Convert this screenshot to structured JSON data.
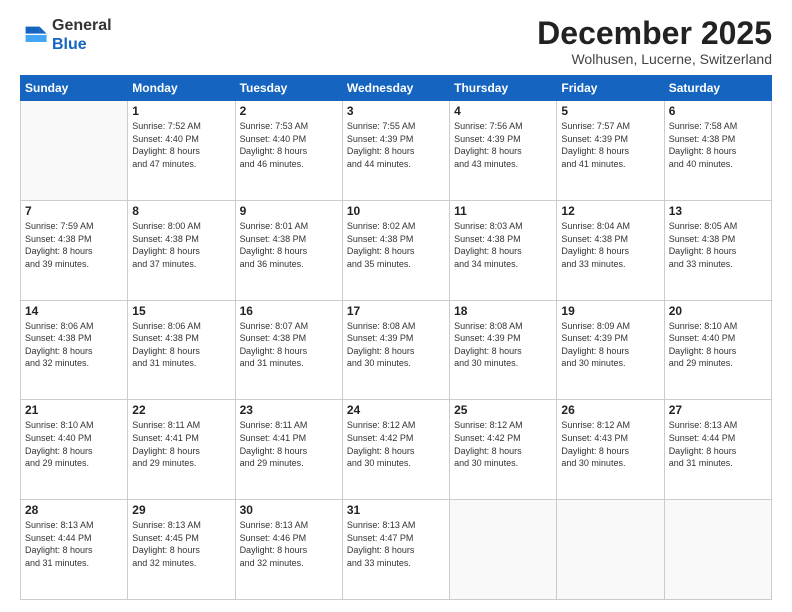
{
  "logo": {
    "general": "General",
    "blue": "Blue"
  },
  "header": {
    "month": "December 2025",
    "location": "Wolhusen, Lucerne, Switzerland"
  },
  "days_of_week": [
    "Sunday",
    "Monday",
    "Tuesday",
    "Wednesday",
    "Thursday",
    "Friday",
    "Saturday"
  ],
  "weeks": [
    [
      {
        "day": "",
        "info": ""
      },
      {
        "day": "1",
        "info": "Sunrise: 7:52 AM\nSunset: 4:40 PM\nDaylight: 8 hours\nand 47 minutes."
      },
      {
        "day": "2",
        "info": "Sunrise: 7:53 AM\nSunset: 4:40 PM\nDaylight: 8 hours\nand 46 minutes."
      },
      {
        "day": "3",
        "info": "Sunrise: 7:55 AM\nSunset: 4:39 PM\nDaylight: 8 hours\nand 44 minutes."
      },
      {
        "day": "4",
        "info": "Sunrise: 7:56 AM\nSunset: 4:39 PM\nDaylight: 8 hours\nand 43 minutes."
      },
      {
        "day": "5",
        "info": "Sunrise: 7:57 AM\nSunset: 4:39 PM\nDaylight: 8 hours\nand 41 minutes."
      },
      {
        "day": "6",
        "info": "Sunrise: 7:58 AM\nSunset: 4:38 PM\nDaylight: 8 hours\nand 40 minutes."
      }
    ],
    [
      {
        "day": "7",
        "info": "Sunrise: 7:59 AM\nSunset: 4:38 PM\nDaylight: 8 hours\nand 39 minutes."
      },
      {
        "day": "8",
        "info": "Sunrise: 8:00 AM\nSunset: 4:38 PM\nDaylight: 8 hours\nand 37 minutes."
      },
      {
        "day": "9",
        "info": "Sunrise: 8:01 AM\nSunset: 4:38 PM\nDaylight: 8 hours\nand 36 minutes."
      },
      {
        "day": "10",
        "info": "Sunrise: 8:02 AM\nSunset: 4:38 PM\nDaylight: 8 hours\nand 35 minutes."
      },
      {
        "day": "11",
        "info": "Sunrise: 8:03 AM\nSunset: 4:38 PM\nDaylight: 8 hours\nand 34 minutes."
      },
      {
        "day": "12",
        "info": "Sunrise: 8:04 AM\nSunset: 4:38 PM\nDaylight: 8 hours\nand 33 minutes."
      },
      {
        "day": "13",
        "info": "Sunrise: 8:05 AM\nSunset: 4:38 PM\nDaylight: 8 hours\nand 33 minutes."
      }
    ],
    [
      {
        "day": "14",
        "info": "Sunrise: 8:06 AM\nSunset: 4:38 PM\nDaylight: 8 hours\nand 32 minutes."
      },
      {
        "day": "15",
        "info": "Sunrise: 8:06 AM\nSunset: 4:38 PM\nDaylight: 8 hours\nand 31 minutes."
      },
      {
        "day": "16",
        "info": "Sunrise: 8:07 AM\nSunset: 4:38 PM\nDaylight: 8 hours\nand 31 minutes."
      },
      {
        "day": "17",
        "info": "Sunrise: 8:08 AM\nSunset: 4:39 PM\nDaylight: 8 hours\nand 30 minutes."
      },
      {
        "day": "18",
        "info": "Sunrise: 8:08 AM\nSunset: 4:39 PM\nDaylight: 8 hours\nand 30 minutes."
      },
      {
        "day": "19",
        "info": "Sunrise: 8:09 AM\nSunset: 4:39 PM\nDaylight: 8 hours\nand 30 minutes."
      },
      {
        "day": "20",
        "info": "Sunrise: 8:10 AM\nSunset: 4:40 PM\nDaylight: 8 hours\nand 29 minutes."
      }
    ],
    [
      {
        "day": "21",
        "info": "Sunrise: 8:10 AM\nSunset: 4:40 PM\nDaylight: 8 hours\nand 29 minutes."
      },
      {
        "day": "22",
        "info": "Sunrise: 8:11 AM\nSunset: 4:41 PM\nDaylight: 8 hours\nand 29 minutes."
      },
      {
        "day": "23",
        "info": "Sunrise: 8:11 AM\nSunset: 4:41 PM\nDaylight: 8 hours\nand 29 minutes."
      },
      {
        "day": "24",
        "info": "Sunrise: 8:12 AM\nSunset: 4:42 PM\nDaylight: 8 hours\nand 30 minutes."
      },
      {
        "day": "25",
        "info": "Sunrise: 8:12 AM\nSunset: 4:42 PM\nDaylight: 8 hours\nand 30 minutes."
      },
      {
        "day": "26",
        "info": "Sunrise: 8:12 AM\nSunset: 4:43 PM\nDaylight: 8 hours\nand 30 minutes."
      },
      {
        "day": "27",
        "info": "Sunrise: 8:13 AM\nSunset: 4:44 PM\nDaylight: 8 hours\nand 31 minutes."
      }
    ],
    [
      {
        "day": "28",
        "info": "Sunrise: 8:13 AM\nSunset: 4:44 PM\nDaylight: 8 hours\nand 31 minutes."
      },
      {
        "day": "29",
        "info": "Sunrise: 8:13 AM\nSunset: 4:45 PM\nDaylight: 8 hours\nand 32 minutes."
      },
      {
        "day": "30",
        "info": "Sunrise: 8:13 AM\nSunset: 4:46 PM\nDaylight: 8 hours\nand 32 minutes."
      },
      {
        "day": "31",
        "info": "Sunrise: 8:13 AM\nSunset: 4:47 PM\nDaylight: 8 hours\nand 33 minutes."
      },
      {
        "day": "",
        "info": ""
      },
      {
        "day": "",
        "info": ""
      },
      {
        "day": "",
        "info": ""
      }
    ]
  ]
}
